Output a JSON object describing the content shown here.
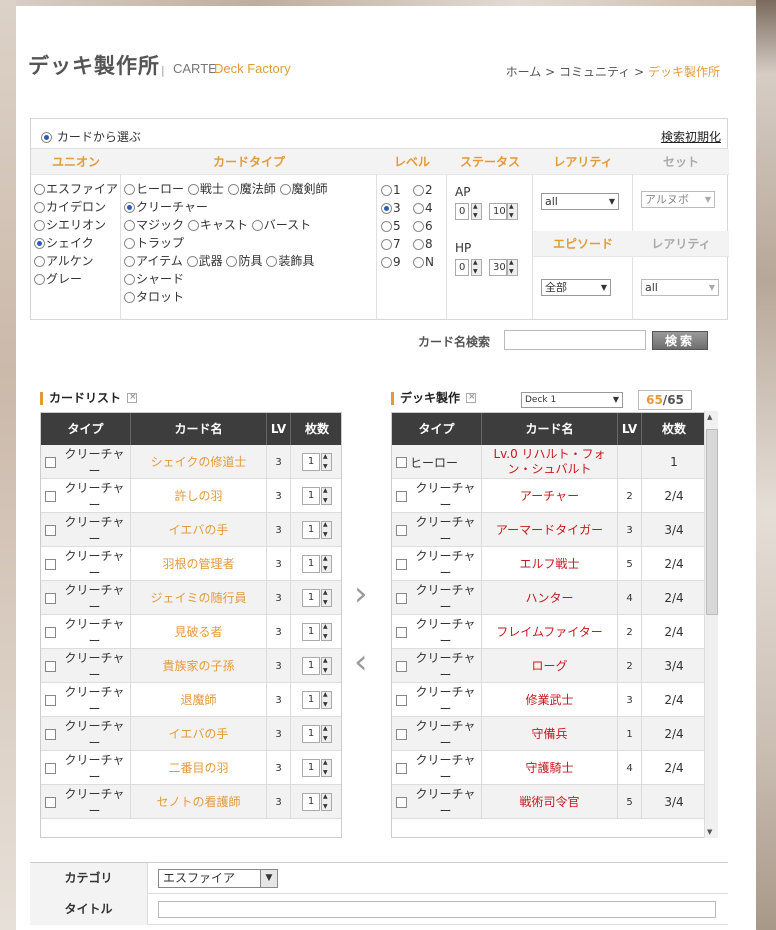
{
  "header": {
    "title": "デッキ製作所",
    "separator": "|",
    "sub_carte": "CARTE",
    "sub_factory": "Deck Factory",
    "breadcrumb": [
      "ホーム",
      "コミュニティ",
      "デッキ製作所"
    ],
    "breadcrumb_sep": ">"
  },
  "filter": {
    "select_from_cards": "カードから選ぶ",
    "reset_link": "検索初期化",
    "headers": {
      "union": "ユニオン",
      "card_type": "カードタイプ",
      "level": "レベル",
      "status": "ステータス",
      "rarity": "レアリティ",
      "set": "セット",
      "episode": "エピソード",
      "rarity2": "レアリティ"
    },
    "unions": [
      "エスファイア",
      "カイデロン",
      "シエリオン",
      "シェイク",
      "アルケン",
      "グレー"
    ],
    "card_types_row1": [
      "ヒーロー",
      "戦士",
      "魔法師",
      "魔剣師"
    ],
    "card_types_row2": [
      "クリーチャー"
    ],
    "card_types_row3": [
      "マジック",
      "キャスト",
      "バースト"
    ],
    "card_types_row4": [
      "トラップ"
    ],
    "card_types_row5": [
      "アイテム",
      "武器",
      "防具",
      "装飾具"
    ],
    "card_types_row6": [
      "シャード"
    ],
    "card_types_row7": [
      "タロット"
    ],
    "levels": [
      "1",
      "2",
      "3",
      "4",
      "5",
      "6",
      "7",
      "8",
      "9",
      "N"
    ],
    "ap_label": "AP",
    "ap_min": "0",
    "ap_max": "10",
    "hp_label": "HP",
    "hp_min": "0",
    "hp_max": "30",
    "rarity_value": "all",
    "set_value": "アルヌボ",
    "episode_value": "全部",
    "rarity2_value": "all"
  },
  "search": {
    "label": "カード名検索",
    "placeholder": "",
    "button": "検索"
  },
  "card_list": {
    "title": "カードリスト",
    "columns": [
      "タイプ",
      "カード名",
      "LV",
      "枚数"
    ],
    "rows": [
      {
        "type": "クリーチャー",
        "name": "シェイクの修道士",
        "lv": "3",
        "qty": "1"
      },
      {
        "type": "クリーチャー",
        "name": "許しの羽",
        "lv": "3",
        "qty": "1"
      },
      {
        "type": "クリーチャー",
        "name": "イエバの手",
        "lv": "3",
        "qty": "1"
      },
      {
        "type": "クリーチャー",
        "name": "羽根の管理者",
        "lv": "3",
        "qty": "1"
      },
      {
        "type": "クリーチャー",
        "name": "ジェイミの随行員",
        "lv": "3",
        "qty": "1"
      },
      {
        "type": "クリーチャー",
        "name": "見破る者",
        "lv": "3",
        "qty": "1"
      },
      {
        "type": "クリーチャー",
        "name": "貴族家の子孫",
        "lv": "3",
        "qty": "1"
      },
      {
        "type": "クリーチャー",
        "name": "退魔師",
        "lv": "3",
        "qty": "1"
      },
      {
        "type": "クリーチャー",
        "name": "イエバの手",
        "lv": "3",
        "qty": "1"
      },
      {
        "type": "クリーチャー",
        "name": "二番目の羽",
        "lv": "3",
        "qty": "1"
      },
      {
        "type": "クリーチャー",
        "name": "セノトの看護師",
        "lv": "3",
        "qty": "1"
      }
    ]
  },
  "deck": {
    "title": "デッキ製作",
    "deck_select": "Deck 1",
    "count_current": "65",
    "count_sep": "/",
    "count_max": "65",
    "columns": [
      "タイプ",
      "カード名",
      "LV",
      "枚数"
    ],
    "rows": [
      {
        "type": "ヒーロー",
        "name": "Lv.0 リハルト・フォン・シュバルト",
        "lv": "",
        "qty": "1"
      },
      {
        "type": "クリーチャー",
        "name": "アーチャー",
        "lv": "2",
        "qty": "2/4"
      },
      {
        "type": "クリーチャー",
        "name": "アーマードタイガー",
        "lv": "3",
        "qty": "3/4"
      },
      {
        "type": "クリーチャー",
        "name": "エルフ戦士",
        "lv": "5",
        "qty": "2/4"
      },
      {
        "type": "クリーチャー",
        "name": "ハンター",
        "lv": "4",
        "qty": "2/4"
      },
      {
        "type": "クリーチャー",
        "name": "フレイムファイター",
        "lv": "2",
        "qty": "2/4"
      },
      {
        "type": "クリーチャー",
        "name": "ローグ",
        "lv": "2",
        "qty": "3/4"
      },
      {
        "type": "クリーチャー",
        "name": "修業武士",
        "lv": "3",
        "qty": "2/4"
      },
      {
        "type": "クリーチャー",
        "name": "守備兵",
        "lv": "1",
        "qty": "2/4"
      },
      {
        "type": "クリーチャー",
        "name": "守護騎士",
        "lv": "4",
        "qty": "2/4"
      },
      {
        "type": "クリーチャー",
        "name": "戦術司令官",
        "lv": "5",
        "qty": "3/4"
      }
    ]
  },
  "form": {
    "category_label": "カテゴリ",
    "category_value": "エスファイア",
    "title_label": "タイトル",
    "title_value": ""
  },
  "colors": {
    "accent": "#e39a3b",
    "deck_name": "#c6191f",
    "table_header": "#3d3d3d"
  }
}
